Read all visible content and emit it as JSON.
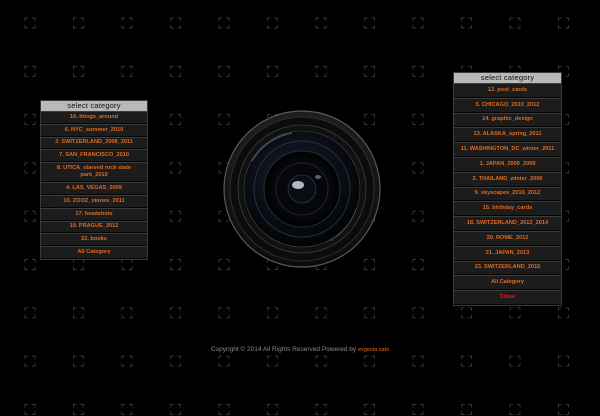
{
  "left_menu": {
    "header": "select category",
    "items": [
      "16. things_around",
      "6. NYC_summer_2010",
      "3. SWITZERLAND_2008_2011",
      "7. SAN_FRANCISCO_2010",
      "8. UTICA_starved rock state park_2010",
      "4. LAS_VEGAS_2009",
      "10. ZOOZ_stones_2011",
      "17. headshots",
      "19. PRAGUE_2012",
      "22. books",
      "All Category"
    ]
  },
  "right_menu": {
    "header": "select category",
    "items": [
      "12. post_cards",
      "5. CHICAGO_2010_2012",
      "14. graphic_design",
      "13. ALASKA_spring_2011",
      "11. WASHINGTON_DC_winter_2011",
      "1. JAPAN_2006_2009",
      "2. THAILAND_winter_2006",
      "9. skyscapes_2010_2012",
      "15. birthday_cards",
      "18. SWITZERLAND_2012_2014",
      "20. ROME_2012",
      "21. JAPAN_2013",
      "23. SWITZERLAND_2015",
      "All Category"
    ],
    "close_label": "Close"
  },
  "footer": {
    "copyright": "Copyright © 2014 All Rights Reserved Powered by",
    "author": "evgenia sato"
  },
  "colors": {
    "accent": "#e26a1a",
    "close": "#e02020",
    "header_bg": "#b9b9b9",
    "background": "#000000"
  }
}
